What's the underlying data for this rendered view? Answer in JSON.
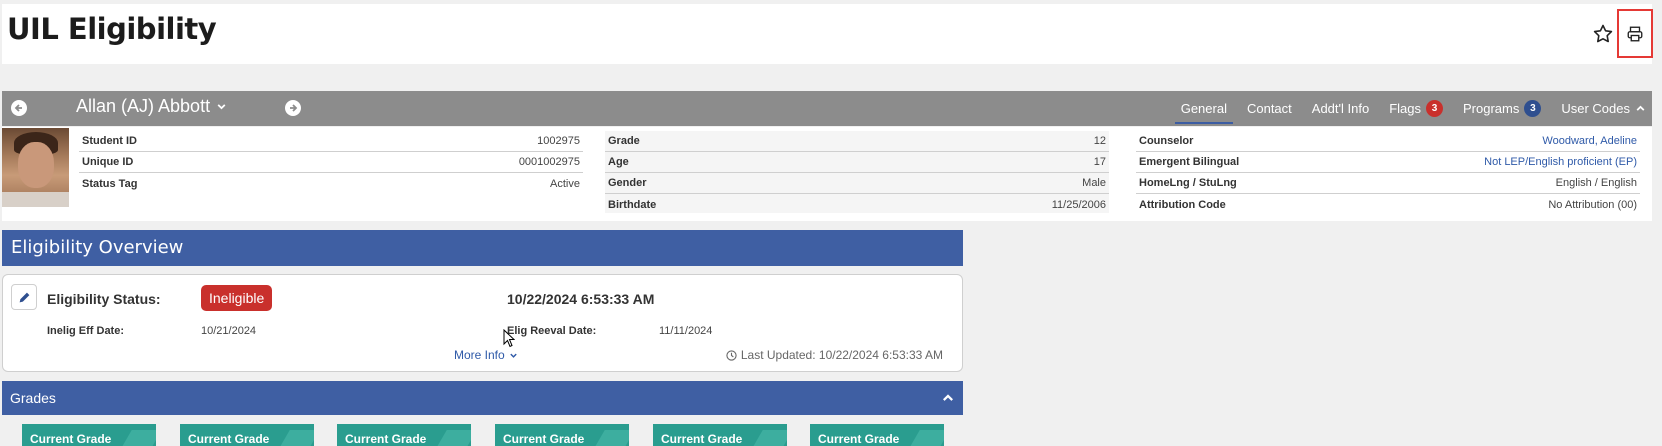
{
  "header": {
    "title": "UIL Eligibility",
    "favorite_icon": "star-outline-icon",
    "print_icon": "printer-icon"
  },
  "student_bar": {
    "name": "Allan (AJ) Abbott",
    "tabs": [
      {
        "label": "General",
        "active": true
      },
      {
        "label": "Contact"
      },
      {
        "label": "Addt'l Info"
      },
      {
        "label": "Flags",
        "badge": "3",
        "badge_color": "#c9302c"
      },
      {
        "label": "Programs",
        "badge": "3",
        "badge_color": "#2f4f8f"
      },
      {
        "label": "User Codes"
      }
    ]
  },
  "student_info": {
    "col1": [
      {
        "label": "Student ID",
        "value": "1002975"
      },
      {
        "label": "Unique ID",
        "value": "0001002975"
      },
      {
        "label": "Status Tag",
        "value": "Active"
      }
    ],
    "col2": [
      {
        "label": "Grade",
        "value": "12"
      },
      {
        "label": "Age",
        "value": "17"
      },
      {
        "label": "Gender",
        "value": "Male"
      },
      {
        "label": "Birthdate",
        "value": "11/25/2006"
      }
    ],
    "col3": [
      {
        "label": "Counselor",
        "value": "Woodward, Adeline"
      },
      {
        "label": "Emergent Bilingual",
        "value": "Not LEP/English proficient (EP)"
      },
      {
        "label": "HomeLng / StuLng",
        "value": "English / English"
      },
      {
        "label": "Attribution Code",
        "value": "No Attribution (00)"
      }
    ]
  },
  "eligibility": {
    "section_title": "Eligibility Overview",
    "status_label": "Eligibility Status:",
    "status_value": "Ineligible",
    "status_color": "#c9302c",
    "status_datetime": "10/22/2024 6:53:33 AM",
    "inelig_eff_label": "Inelig Eff Date:",
    "inelig_eff_value": "10/21/2024",
    "reeval_label": "Elig Reeval Date:",
    "reeval_value": "11/11/2024",
    "more_info": "More Info",
    "last_updated": "Last Updated: 10/22/2024 6:53:33 AM"
  },
  "grades": {
    "title": "Grades",
    "cards": [
      "Current Grade",
      "Current Grade",
      "Current Grade",
      "Current Grade",
      "Current Grade",
      "Current Grade"
    ]
  },
  "colors": {
    "accent": "#3f5fa3",
    "danger": "#c9302c",
    "teal": "#2a9d8f"
  }
}
